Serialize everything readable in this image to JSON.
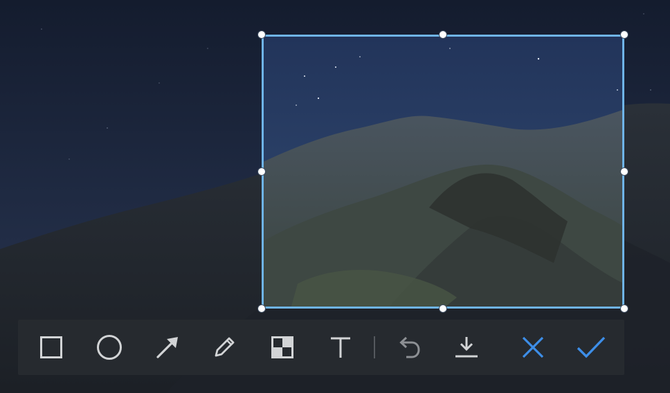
{
  "colors": {
    "sky_top": "#141c2e",
    "sky_bottom": "#2d3b58",
    "selection_border": "#6fb4e8",
    "toolbar_bg": "#262a2f",
    "icon_color": "#d2d4d6",
    "undo_disabled_color": "#8d9094",
    "accent_blue": "#3d8ee8"
  },
  "toolbar": {
    "tools": [
      {
        "name": "rectangle-tool",
        "icon": "square-outline-icon"
      },
      {
        "name": "ellipse-tool",
        "icon": "circle-outline-icon"
      },
      {
        "name": "arrow-tool",
        "icon": "arrow-diagonal-icon"
      },
      {
        "name": "pen-tool",
        "icon": "pencil-icon"
      },
      {
        "name": "mosaic-tool",
        "icon": "mosaic-icon"
      },
      {
        "name": "text-tool",
        "icon": "text-t-icon"
      }
    ],
    "actions": [
      {
        "name": "undo-button",
        "icon": "undo-icon",
        "enabled": false
      },
      {
        "name": "download-button",
        "icon": "download-icon",
        "enabled": true
      },
      {
        "name": "cancel-button",
        "icon": "close-icon",
        "enabled": true
      },
      {
        "name": "confirm-button",
        "icon": "checkmark-icon",
        "enabled": true
      }
    ]
  }
}
